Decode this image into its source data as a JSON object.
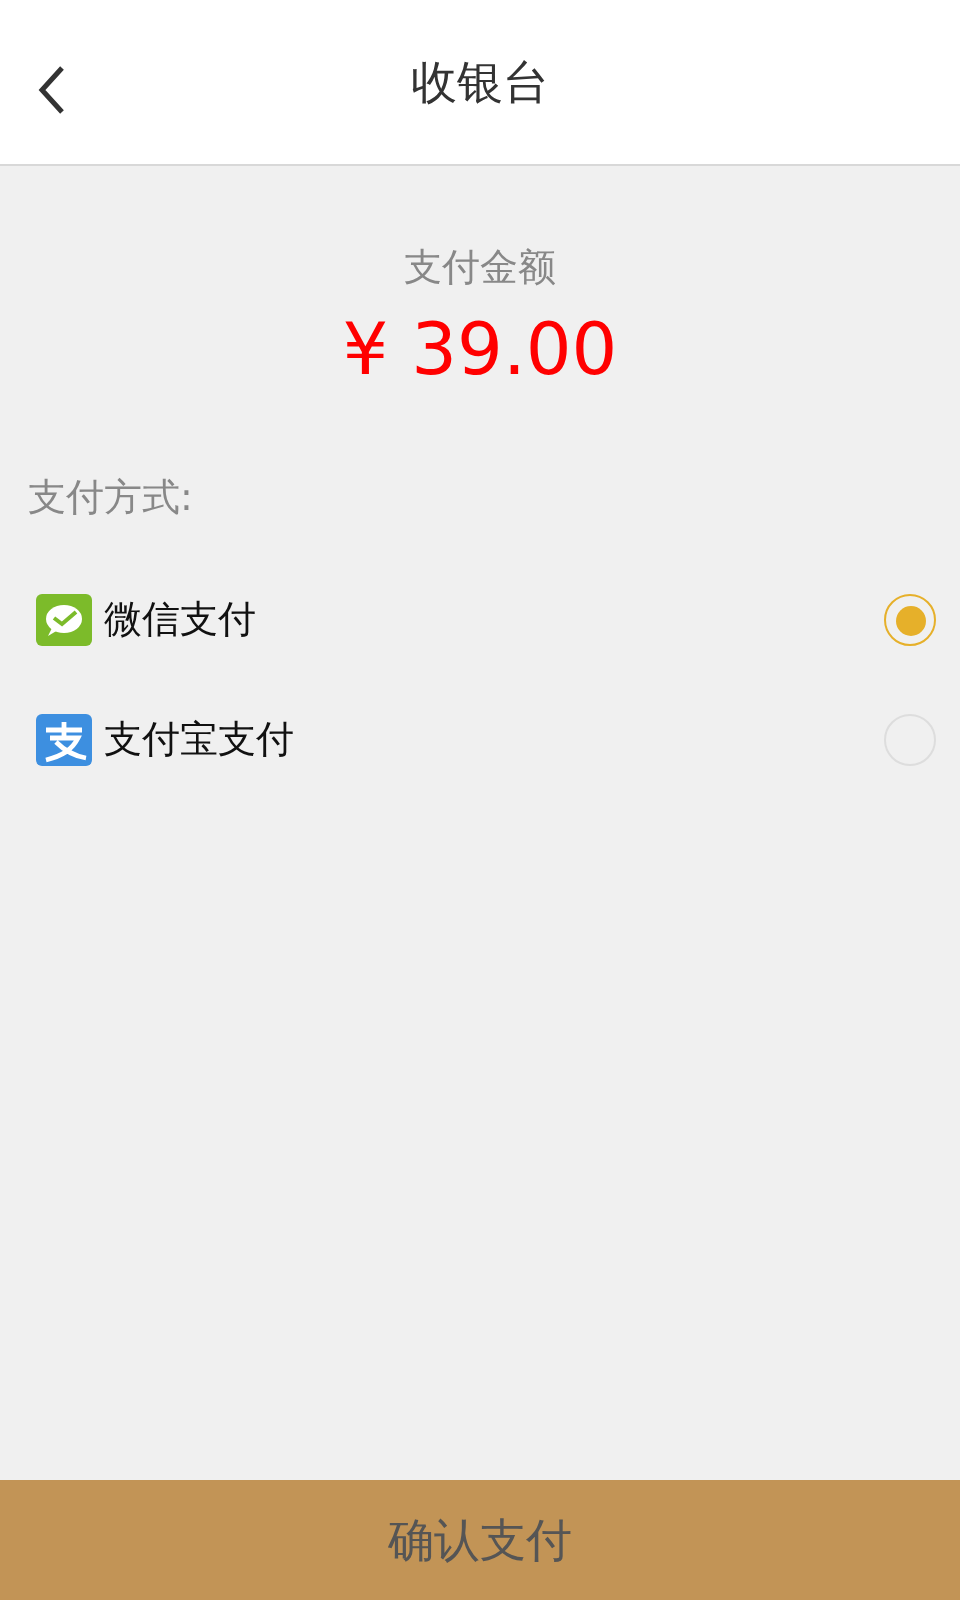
{
  "header": {
    "title": "收银台"
  },
  "amount": {
    "label": "支付金额",
    "value": "¥ 39.00"
  },
  "methods_label": "支付方式:",
  "methods": [
    {
      "kind": "chat",
      "label": "微信支付",
      "selected": true
    },
    {
      "kind": "zhi",
      "label": "支付宝支付",
      "selected": false
    }
  ],
  "confirm_button": "确认支付"
}
